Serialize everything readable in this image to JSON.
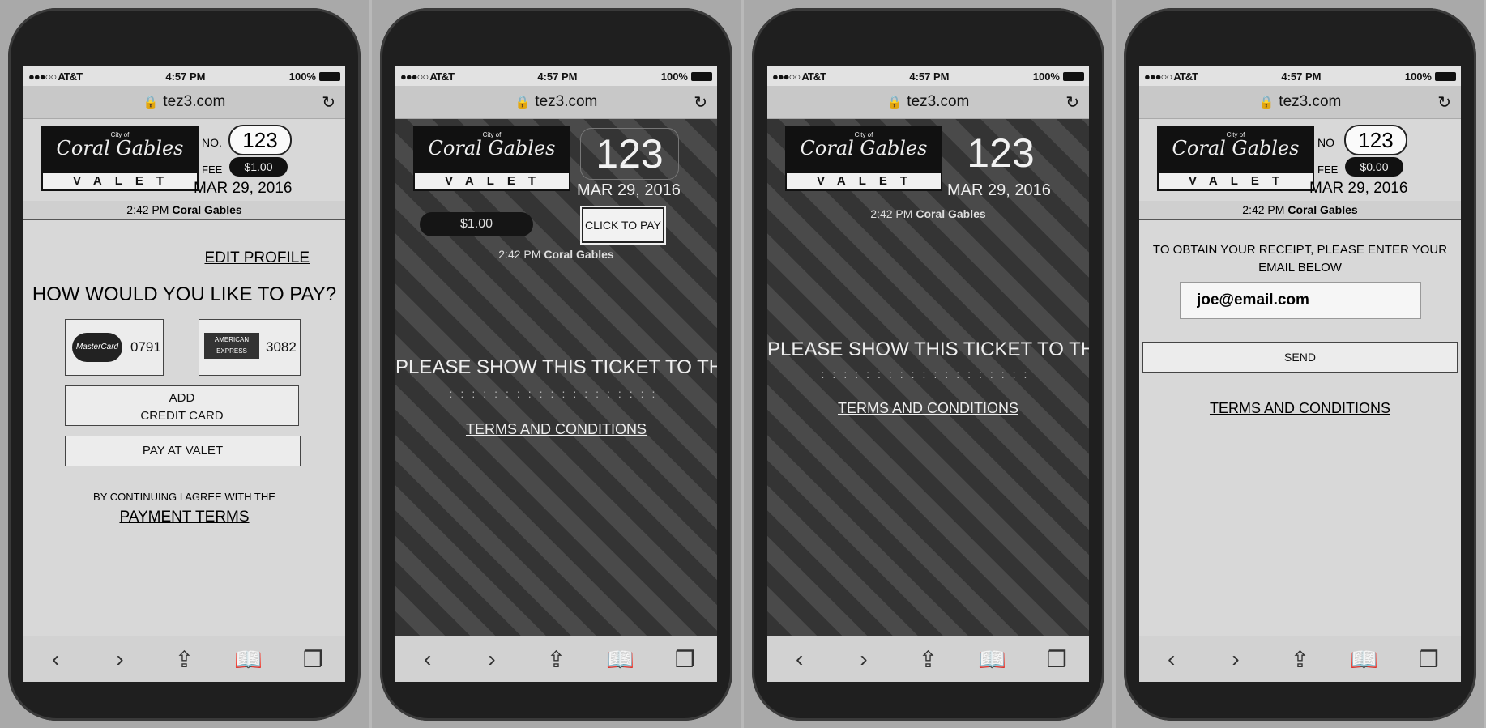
{
  "status": {
    "carrier": "●●●○○ AT&T",
    "time": "4:57 PM",
    "battery": "100%"
  },
  "url": "tez3.com",
  "logo": {
    "city": "City of",
    "name": "Coral Gables",
    "valet": "VALET"
  },
  "ticket": {
    "no_label": "NO.",
    "no_label_plain": "NO",
    "number": "123",
    "fee_label": "FEE",
    "fee": "$1.00",
    "fee_zero": "$0.00",
    "date": "MAR 29, 2016",
    "time": "2:42 PM",
    "location": "Coral Gables"
  },
  "panel1": {
    "edit_profile": "EDIT PROFILE",
    "question": "HOW WOULD YOU LIKE TO PAY?",
    "cards": [
      {
        "brand": "MasterCard",
        "last4": "0791"
      },
      {
        "brand": "AMERICAN EXPRESS",
        "last4": "3082"
      }
    ],
    "add_card_line1": "ADD",
    "add_card_line2": "CREDIT CARD",
    "pay_at_valet": "PAY AT VALET",
    "agree_text": "BY CONTINUING I AGREE WITH THE",
    "payment_terms": "PAYMENT TERMS"
  },
  "panel2": {
    "fee": "$1.00",
    "click_to_pay": "CLICK TO PAY",
    "show_ticket": "PLEASE SHOW THIS TICKET TO THE VALET",
    "terms": "TERMS AND CONDITIONS"
  },
  "panel3": {
    "show_ticket": "PLEASE SHOW THIS TICKET TO THE VALET",
    "terms": "TERMS AND CONDITIONS"
  },
  "panel4": {
    "receipt_prompt": "TO OBTAIN YOUR RECEIPT, PLEASE ENTER YOUR EMAIL BELOW",
    "email_value": "joe@email.com",
    "send": "SEND",
    "terms": "TERMS AND CONDITIONS"
  },
  "toolbar": {
    "back": "‹",
    "forward": "›",
    "share": "⇪",
    "bookmarks": "📖",
    "tabs": "❐"
  }
}
